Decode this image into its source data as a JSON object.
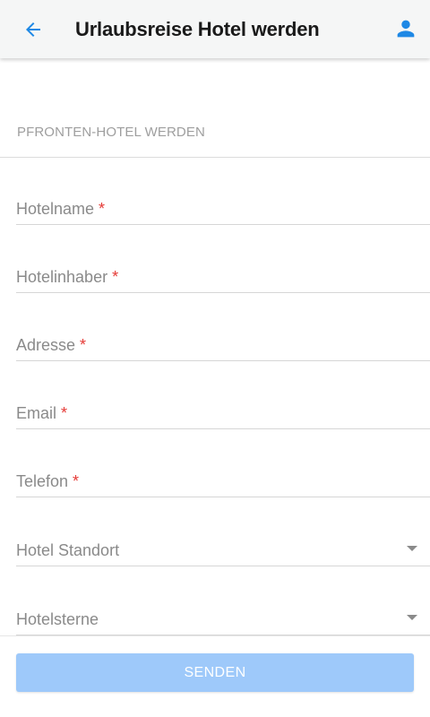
{
  "appbar": {
    "title": "Urlaubsreise Hotel werden",
    "back_icon": "arrow-left-icon",
    "profile_icon": "person-icon",
    "accent_color": "#1e88e5"
  },
  "form": {
    "section_label": "PFRONTEN-HOTEL WERDEN",
    "required_marker": "*",
    "fields": [
      {
        "label": "Hotelname",
        "required": true,
        "type": "text"
      },
      {
        "label": "Hotelinhaber",
        "required": true,
        "type": "text"
      },
      {
        "label": "Adresse",
        "required": true,
        "type": "text"
      },
      {
        "label": "Email",
        "required": true,
        "type": "text"
      },
      {
        "label": "Telefon",
        "required": true,
        "type": "text"
      },
      {
        "label": "Hotel Standort",
        "required": false,
        "type": "select"
      },
      {
        "label": "Hotelsterne",
        "required": false,
        "type": "select"
      }
    ],
    "submit_label": "SENDEN",
    "submit_color": "#9ec9fa",
    "required_color": "#e53935"
  }
}
